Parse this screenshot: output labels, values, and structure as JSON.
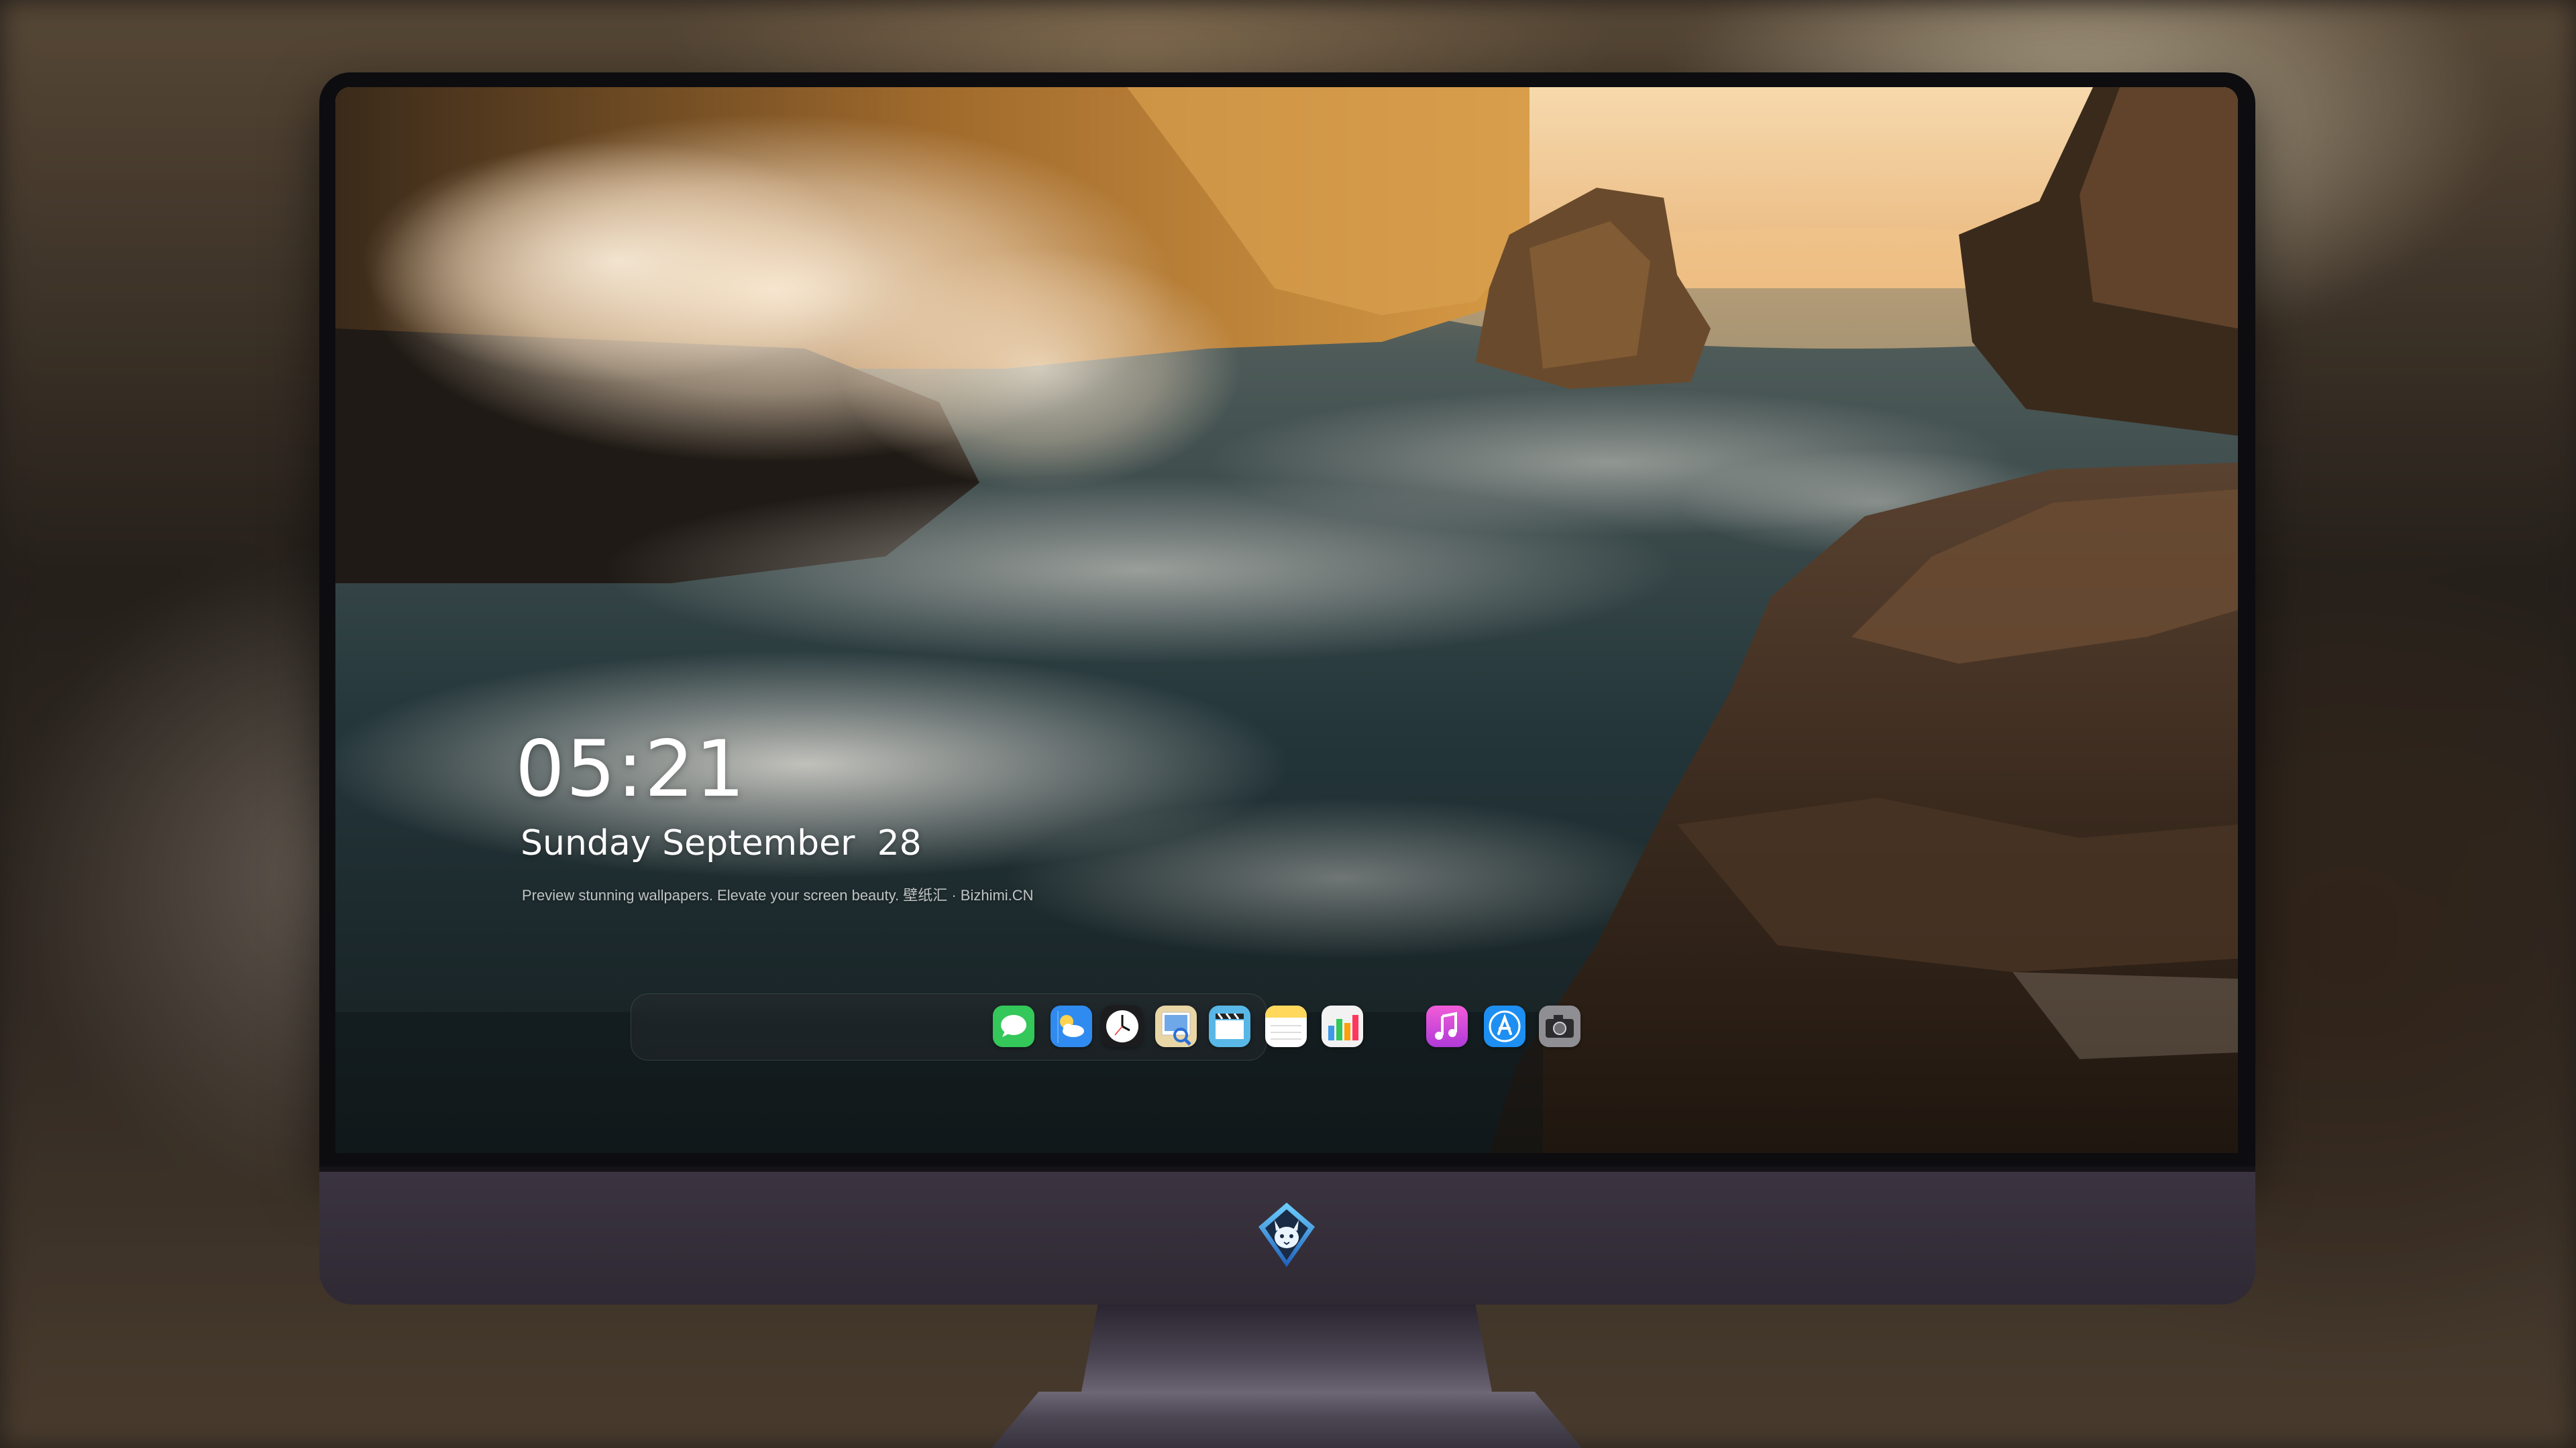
{
  "lock_screen": {
    "time": "05:21",
    "date": "Sunday September  28",
    "tagline": "Preview stunning wallpapers. Elevate your screen beauty. 壁纸汇 · Bizhimi.CN"
  },
  "dock": {
    "apps": [
      {
        "name": "Messages",
        "icon": "messages-icon",
        "color": "#34c759"
      },
      {
        "name": "Weather",
        "icon": "weather-icon",
        "color": "#2f8bf0"
      },
      {
        "name": "Clock",
        "icon": "clock-icon",
        "color": "#1c1c1e"
      },
      {
        "name": "Preview",
        "icon": "preview-icon",
        "color": "#e9d6a6"
      },
      {
        "name": "Clips",
        "icon": "clapperboard-icon",
        "color": "#58b7e6"
      },
      {
        "name": "Notes",
        "icon": "notes-icon",
        "color": "#ffd85c"
      },
      {
        "name": "Numbers",
        "icon": "numbers-icon",
        "color": "#f2f2f2"
      },
      {
        "name": "Music",
        "icon": "music-icon",
        "color": "#d24fd6"
      },
      {
        "name": "App Store",
        "icon": "app-store-icon",
        "color": "#1d8ff2"
      },
      {
        "name": "Camera",
        "icon": "camera-icon",
        "color": "#8e8e93"
      }
    ]
  },
  "device": {
    "logo": "wolf-mascot-logo",
    "bezel_color": "#0d0d10",
    "chin_color": "#352f3a"
  }
}
